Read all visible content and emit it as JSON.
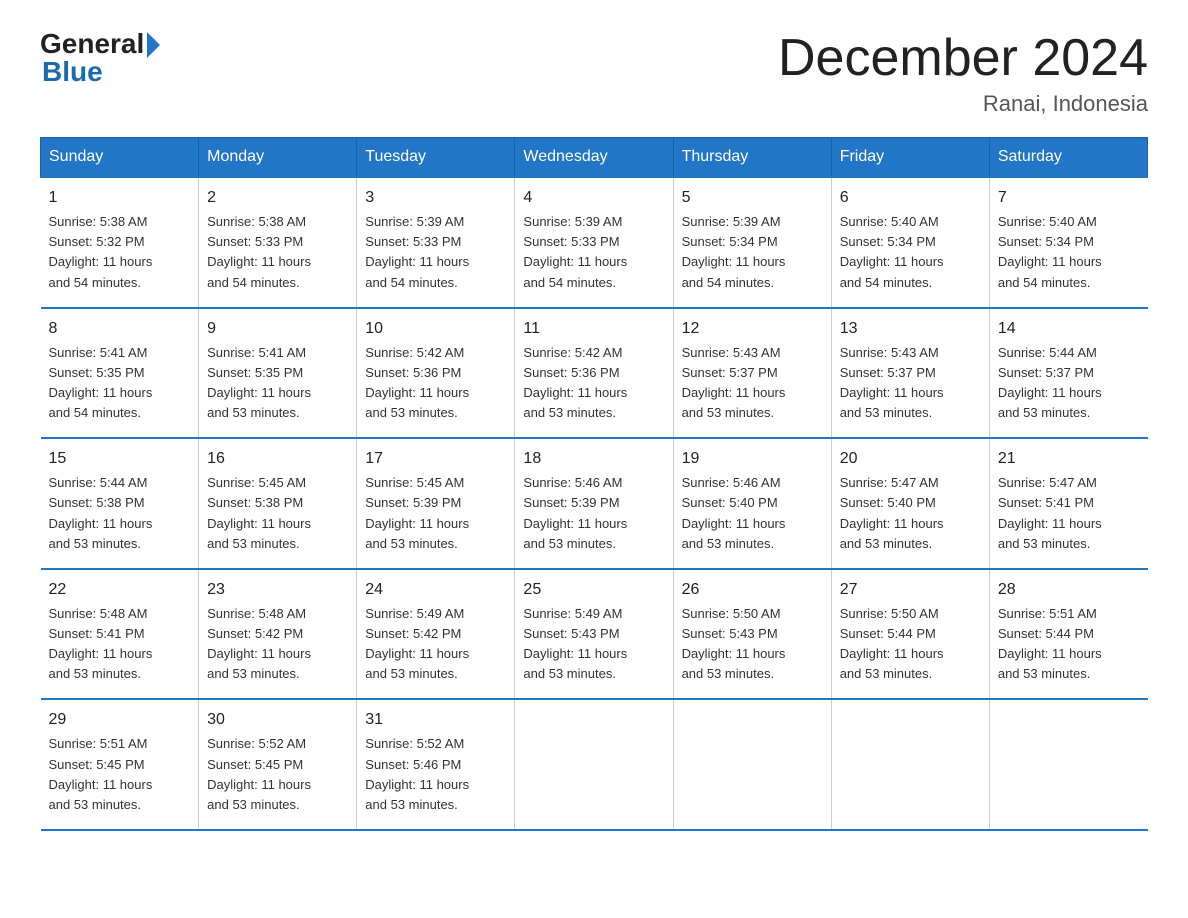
{
  "header": {
    "logo_general": "General",
    "logo_blue": "Blue",
    "title": "December 2024",
    "subtitle": "Ranai, Indonesia"
  },
  "days_of_week": [
    "Sunday",
    "Monday",
    "Tuesday",
    "Wednesday",
    "Thursday",
    "Friday",
    "Saturday"
  ],
  "weeks": [
    [
      {
        "day": "1",
        "sunrise": "5:38 AM",
        "sunset": "5:32 PM",
        "daylight": "11 hours and 54 minutes."
      },
      {
        "day": "2",
        "sunrise": "5:38 AM",
        "sunset": "5:33 PM",
        "daylight": "11 hours and 54 minutes."
      },
      {
        "day": "3",
        "sunrise": "5:39 AM",
        "sunset": "5:33 PM",
        "daylight": "11 hours and 54 minutes."
      },
      {
        "day": "4",
        "sunrise": "5:39 AM",
        "sunset": "5:33 PM",
        "daylight": "11 hours and 54 minutes."
      },
      {
        "day": "5",
        "sunrise": "5:39 AM",
        "sunset": "5:34 PM",
        "daylight": "11 hours and 54 minutes."
      },
      {
        "day": "6",
        "sunrise": "5:40 AM",
        "sunset": "5:34 PM",
        "daylight": "11 hours and 54 minutes."
      },
      {
        "day": "7",
        "sunrise": "5:40 AM",
        "sunset": "5:34 PM",
        "daylight": "11 hours and 54 minutes."
      }
    ],
    [
      {
        "day": "8",
        "sunrise": "5:41 AM",
        "sunset": "5:35 PM",
        "daylight": "11 hours and 54 minutes."
      },
      {
        "day": "9",
        "sunrise": "5:41 AM",
        "sunset": "5:35 PM",
        "daylight": "11 hours and 53 minutes."
      },
      {
        "day": "10",
        "sunrise": "5:42 AM",
        "sunset": "5:36 PM",
        "daylight": "11 hours and 53 minutes."
      },
      {
        "day": "11",
        "sunrise": "5:42 AM",
        "sunset": "5:36 PM",
        "daylight": "11 hours and 53 minutes."
      },
      {
        "day": "12",
        "sunrise": "5:43 AM",
        "sunset": "5:37 PM",
        "daylight": "11 hours and 53 minutes."
      },
      {
        "day": "13",
        "sunrise": "5:43 AM",
        "sunset": "5:37 PM",
        "daylight": "11 hours and 53 minutes."
      },
      {
        "day": "14",
        "sunrise": "5:44 AM",
        "sunset": "5:37 PM",
        "daylight": "11 hours and 53 minutes."
      }
    ],
    [
      {
        "day": "15",
        "sunrise": "5:44 AM",
        "sunset": "5:38 PM",
        "daylight": "11 hours and 53 minutes."
      },
      {
        "day": "16",
        "sunrise": "5:45 AM",
        "sunset": "5:38 PM",
        "daylight": "11 hours and 53 minutes."
      },
      {
        "day": "17",
        "sunrise": "5:45 AM",
        "sunset": "5:39 PM",
        "daylight": "11 hours and 53 minutes."
      },
      {
        "day": "18",
        "sunrise": "5:46 AM",
        "sunset": "5:39 PM",
        "daylight": "11 hours and 53 minutes."
      },
      {
        "day": "19",
        "sunrise": "5:46 AM",
        "sunset": "5:40 PM",
        "daylight": "11 hours and 53 minutes."
      },
      {
        "day": "20",
        "sunrise": "5:47 AM",
        "sunset": "5:40 PM",
        "daylight": "11 hours and 53 minutes."
      },
      {
        "day": "21",
        "sunrise": "5:47 AM",
        "sunset": "5:41 PM",
        "daylight": "11 hours and 53 minutes."
      }
    ],
    [
      {
        "day": "22",
        "sunrise": "5:48 AM",
        "sunset": "5:41 PM",
        "daylight": "11 hours and 53 minutes."
      },
      {
        "day": "23",
        "sunrise": "5:48 AM",
        "sunset": "5:42 PM",
        "daylight": "11 hours and 53 minutes."
      },
      {
        "day": "24",
        "sunrise": "5:49 AM",
        "sunset": "5:42 PM",
        "daylight": "11 hours and 53 minutes."
      },
      {
        "day": "25",
        "sunrise": "5:49 AM",
        "sunset": "5:43 PM",
        "daylight": "11 hours and 53 minutes."
      },
      {
        "day": "26",
        "sunrise": "5:50 AM",
        "sunset": "5:43 PM",
        "daylight": "11 hours and 53 minutes."
      },
      {
        "day": "27",
        "sunrise": "5:50 AM",
        "sunset": "5:44 PM",
        "daylight": "11 hours and 53 minutes."
      },
      {
        "day": "28",
        "sunrise": "5:51 AM",
        "sunset": "5:44 PM",
        "daylight": "11 hours and 53 minutes."
      }
    ],
    [
      {
        "day": "29",
        "sunrise": "5:51 AM",
        "sunset": "5:45 PM",
        "daylight": "11 hours and 53 minutes."
      },
      {
        "day": "30",
        "sunrise": "5:52 AM",
        "sunset": "5:45 PM",
        "daylight": "11 hours and 53 minutes."
      },
      {
        "day": "31",
        "sunrise": "5:52 AM",
        "sunset": "5:46 PM",
        "daylight": "11 hours and 53 minutes."
      },
      null,
      null,
      null,
      null
    ]
  ],
  "labels": {
    "sunrise": "Sunrise:",
    "sunset": "Sunset:",
    "daylight": "Daylight:"
  }
}
